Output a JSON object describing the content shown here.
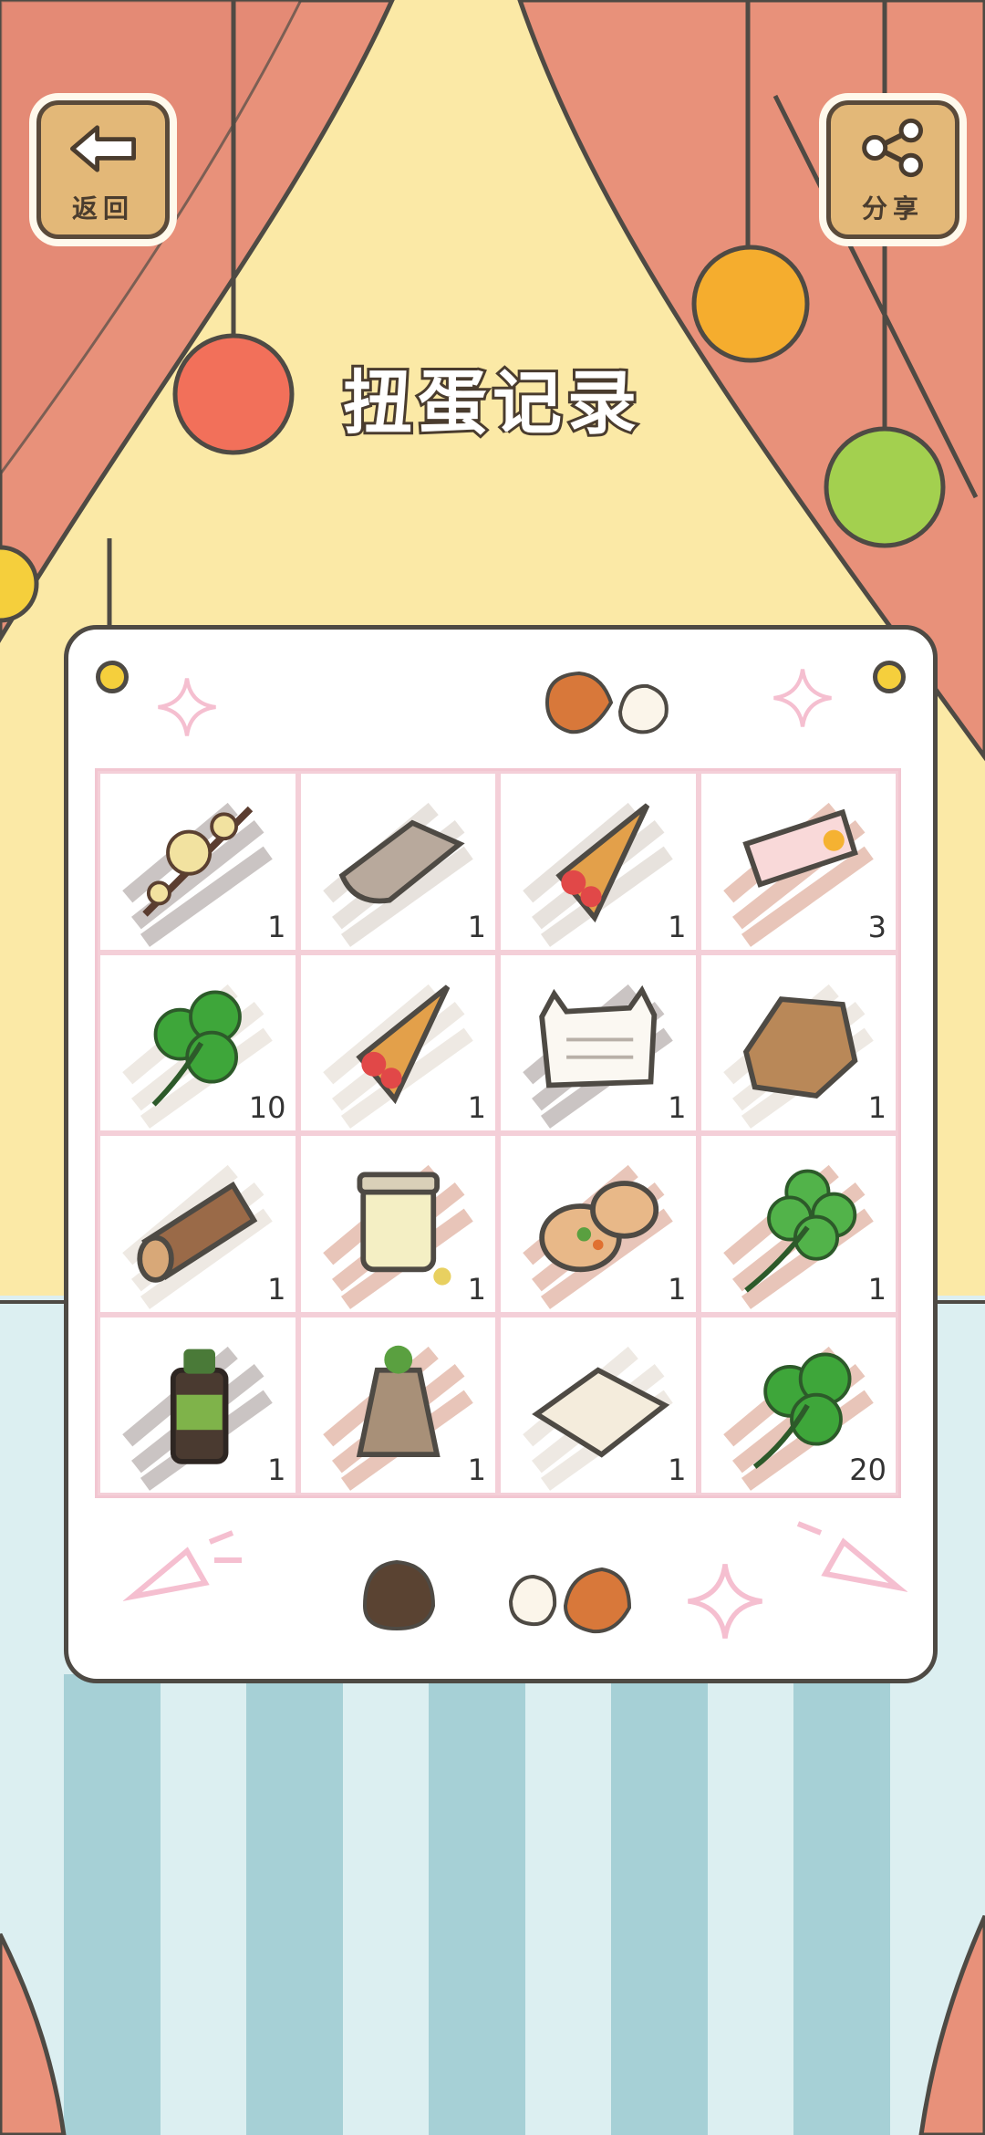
{
  "header": {
    "back_label": "返回",
    "share_label": "分享",
    "title": "扭蛋记录"
  },
  "items": [
    {
      "name": "plum-blossom-branch",
      "count": "1"
    },
    {
      "name": "rolled-cloth",
      "count": "1"
    },
    {
      "name": "strawberry-crepe",
      "count": "1"
    },
    {
      "name": "ticket",
      "count": "3"
    },
    {
      "name": "three-leaf-clover",
      "count": "10"
    },
    {
      "name": "strawberry-crepe",
      "count": "1"
    },
    {
      "name": "cat-letter",
      "count": "1"
    },
    {
      "name": "wrapped-parcel",
      "count": "1"
    },
    {
      "name": "wooden-log",
      "count": "1"
    },
    {
      "name": "jar-of-beans",
      "count": "1"
    },
    {
      "name": "stuffed-pita",
      "count": "1"
    },
    {
      "name": "four-leaf-clover",
      "count": "1"
    },
    {
      "name": "medicine-bottle",
      "count": "1"
    },
    {
      "name": "seed-bag",
      "count": "1"
    },
    {
      "name": "paper-sheets",
      "count": "1"
    },
    {
      "name": "three-leaf-clover",
      "count": "20"
    }
  ],
  "colors": {
    "curtain": "#e8917a",
    "backdrop": "#fbe9a6",
    "stripe_dark": "#a6d0d6",
    "stripe_light": "#dceff1",
    "board_border": "#4e4a44"
  }
}
